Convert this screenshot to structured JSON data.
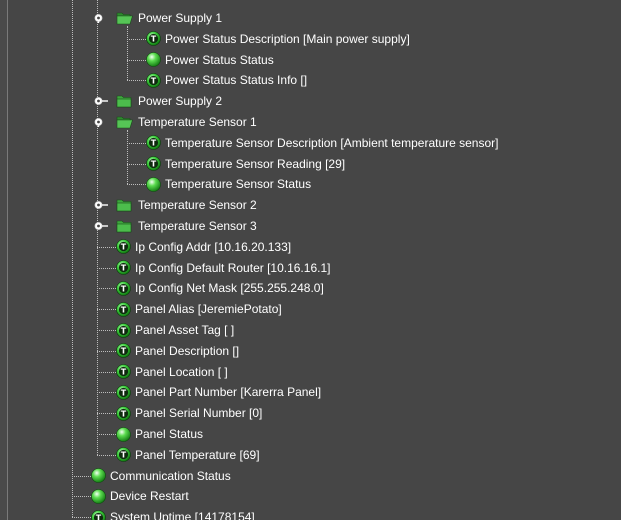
{
  "tree": {
    "nodes": [
      {
        "label": "Power Supply 1",
        "kind": "folder",
        "expanded": true,
        "depth": 0
      },
      {
        "label": "Power Status Description [Main power supply]",
        "kind": "text",
        "depth": 1
      },
      {
        "label": "Power Status Status",
        "kind": "status",
        "depth": 1
      },
      {
        "label": "Power Status Status Info []",
        "kind": "text",
        "depth": 1
      },
      {
        "label": "Power Supply 2",
        "kind": "folder",
        "expanded": false,
        "depth": 0
      },
      {
        "label": "Temperature Sensor 1",
        "kind": "folder",
        "expanded": true,
        "depth": 0
      },
      {
        "label": "Temperature Sensor Description [Ambient temperature sensor]",
        "kind": "text",
        "depth": 1
      },
      {
        "label": "Temperature Sensor Reading [29]",
        "kind": "text",
        "depth": 1
      },
      {
        "label": "Temperature Sensor Status",
        "kind": "status",
        "depth": 1
      },
      {
        "label": "Temperature Sensor 2",
        "kind": "folder",
        "expanded": false,
        "depth": 0
      },
      {
        "label": "Temperature Sensor 3",
        "kind": "folder",
        "expanded": false,
        "depth": 0
      },
      {
        "label": "Ip Config Addr [10.16.20.133]",
        "kind": "text",
        "depth": 0
      },
      {
        "label": "Ip Config Default Router [10.16.16.1]",
        "kind": "text",
        "depth": 0
      },
      {
        "label": "Ip Config Net Mask [255.255.248.0]",
        "kind": "text",
        "depth": 0
      },
      {
        "label": "Panel Alias [JeremiePotato]",
        "kind": "text",
        "depth": 0
      },
      {
        "label": "Panel Asset Tag [ ]",
        "kind": "text",
        "depth": 0
      },
      {
        "label": "Panel Description []",
        "kind": "text",
        "depth": 0
      },
      {
        "label": "Panel Location [ ]",
        "kind": "text",
        "depth": 0
      },
      {
        "label": "Panel Part Number [Karerra Panel]",
        "kind": "text",
        "depth": 0
      },
      {
        "label": "Panel Serial Number [0]",
        "kind": "text",
        "depth": 0
      },
      {
        "label": "Panel Status",
        "kind": "status",
        "depth": 0
      },
      {
        "label": "Panel Temperature [69]",
        "kind": "text",
        "depth": 0
      },
      {
        "label": "Communication Status",
        "kind": "status",
        "depth": -1
      },
      {
        "label": "Device Restart",
        "kind": "status",
        "depth": -1
      },
      {
        "label": "System Uptime [14178154]",
        "kind": "text",
        "depth": -1
      }
    ]
  },
  "icons": {
    "text_node": "text-parameter-icon",
    "status_node": "status-led-icon",
    "folder_node": "folder-icon",
    "expander": "expand-toggle-icon"
  },
  "colors": {
    "panel_bg": "#464646",
    "text": "#ffffff",
    "status_green": "#2fbf2f",
    "folder_green": "#3fa83f"
  }
}
